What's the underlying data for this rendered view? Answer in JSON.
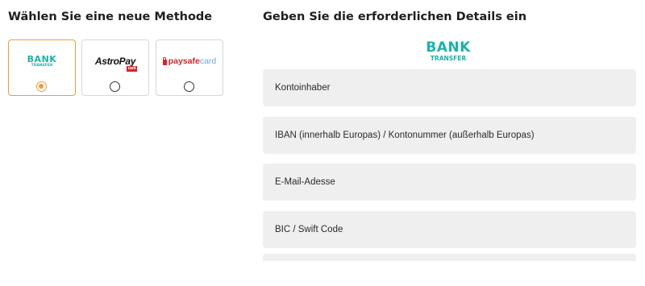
{
  "left_title": "Wählen Sie eine neue Methode",
  "right_title": "Geben Sie die erforderlichen Details ein",
  "methods": [
    {
      "id": "bank-transfer",
      "logo_line1": "BANK",
      "logo_line2": "TRANSFER",
      "selected": true
    },
    {
      "id": "astropay",
      "logo_text": "AstroPay",
      "logo_badge": "card",
      "selected": false
    },
    {
      "id": "paysafecard",
      "logo_text_a": "paysafe",
      "logo_text_b": "card",
      "selected": false
    }
  ],
  "header_logo": {
    "line1": "BANK",
    "line2": "TRANSFER"
  },
  "fields": [
    {
      "placeholder": "Kontoinhaber"
    },
    {
      "placeholder": "IBAN (innerhalb Europas) / Kontonummer (außerhalb Europas)"
    },
    {
      "placeholder": "E-Mail-Adesse"
    },
    {
      "placeholder": "BIC / Swift Code"
    },
    {
      "placeholder": ""
    }
  ],
  "colors": {
    "accent": "#f29a36",
    "bank_teal": "#1bb3a6",
    "field_bg": "#efefef",
    "astropay_red": "#d4232b",
    "paysafe_red": "#d4232b",
    "paysafe_blue": "#6fa8dc"
  },
  "icons": {
    "selected_radio": "radio-checked-icon",
    "unselected_radio": "radio-unchecked-icon",
    "paysafe_lock": "lock-icon"
  }
}
